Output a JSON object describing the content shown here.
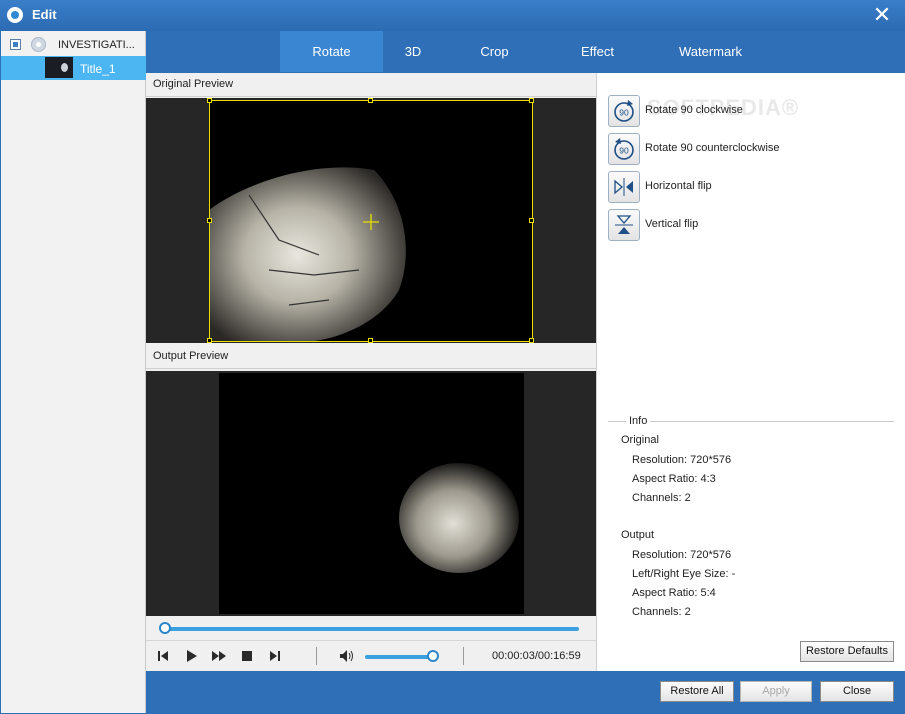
{
  "window": {
    "title": "Edit"
  },
  "sidebar": {
    "items": [
      {
        "label": "INVESTIGATI..."
      },
      {
        "label": "Title_1"
      }
    ]
  },
  "tabs": [
    {
      "label": "Rotate",
      "active": true
    },
    {
      "label": "3D"
    },
    {
      "label": "Crop"
    },
    {
      "label": "Effect"
    },
    {
      "label": "Watermark"
    }
  ],
  "preview": {
    "original_label": "Original Preview",
    "output_label": "Output Preview"
  },
  "player": {
    "time": "00:00:03/00:16:59"
  },
  "rotate": {
    "watermark": "SOFTPEDIA®",
    "options": [
      {
        "label": "Rotate 90 clockwise",
        "icon": "rotate-clockwise-icon"
      },
      {
        "label": "Rotate 90 counterclockwise",
        "icon": "rotate-counterclockwise-icon"
      },
      {
        "label": "Horizontal flip",
        "icon": "horizontal-flip-icon"
      },
      {
        "label": "Vertical flip",
        "icon": "vertical-flip-icon"
      }
    ]
  },
  "info": {
    "title": "Info",
    "original": {
      "heading": "Original",
      "resolution": "Resolution: 720*576",
      "aspect": "Aspect Ratio: 4:3",
      "channels": "Channels: 2"
    },
    "output": {
      "heading": "Output",
      "resolution": "Resolution: 720*576",
      "eye_size": "Left/Right Eye Size: -",
      "aspect": "Aspect Ratio: 5:4",
      "channels": "Channels: 2"
    }
  },
  "buttons": {
    "restore_defaults": "Restore Defaults",
    "restore_all": "Restore All",
    "apply": "Apply",
    "close": "Close"
  },
  "colors": {
    "accent": "#2f6fb8",
    "tab_active": "#3b86d3",
    "selection": "#4cb6f2",
    "crop_frame": "#e8e000"
  }
}
